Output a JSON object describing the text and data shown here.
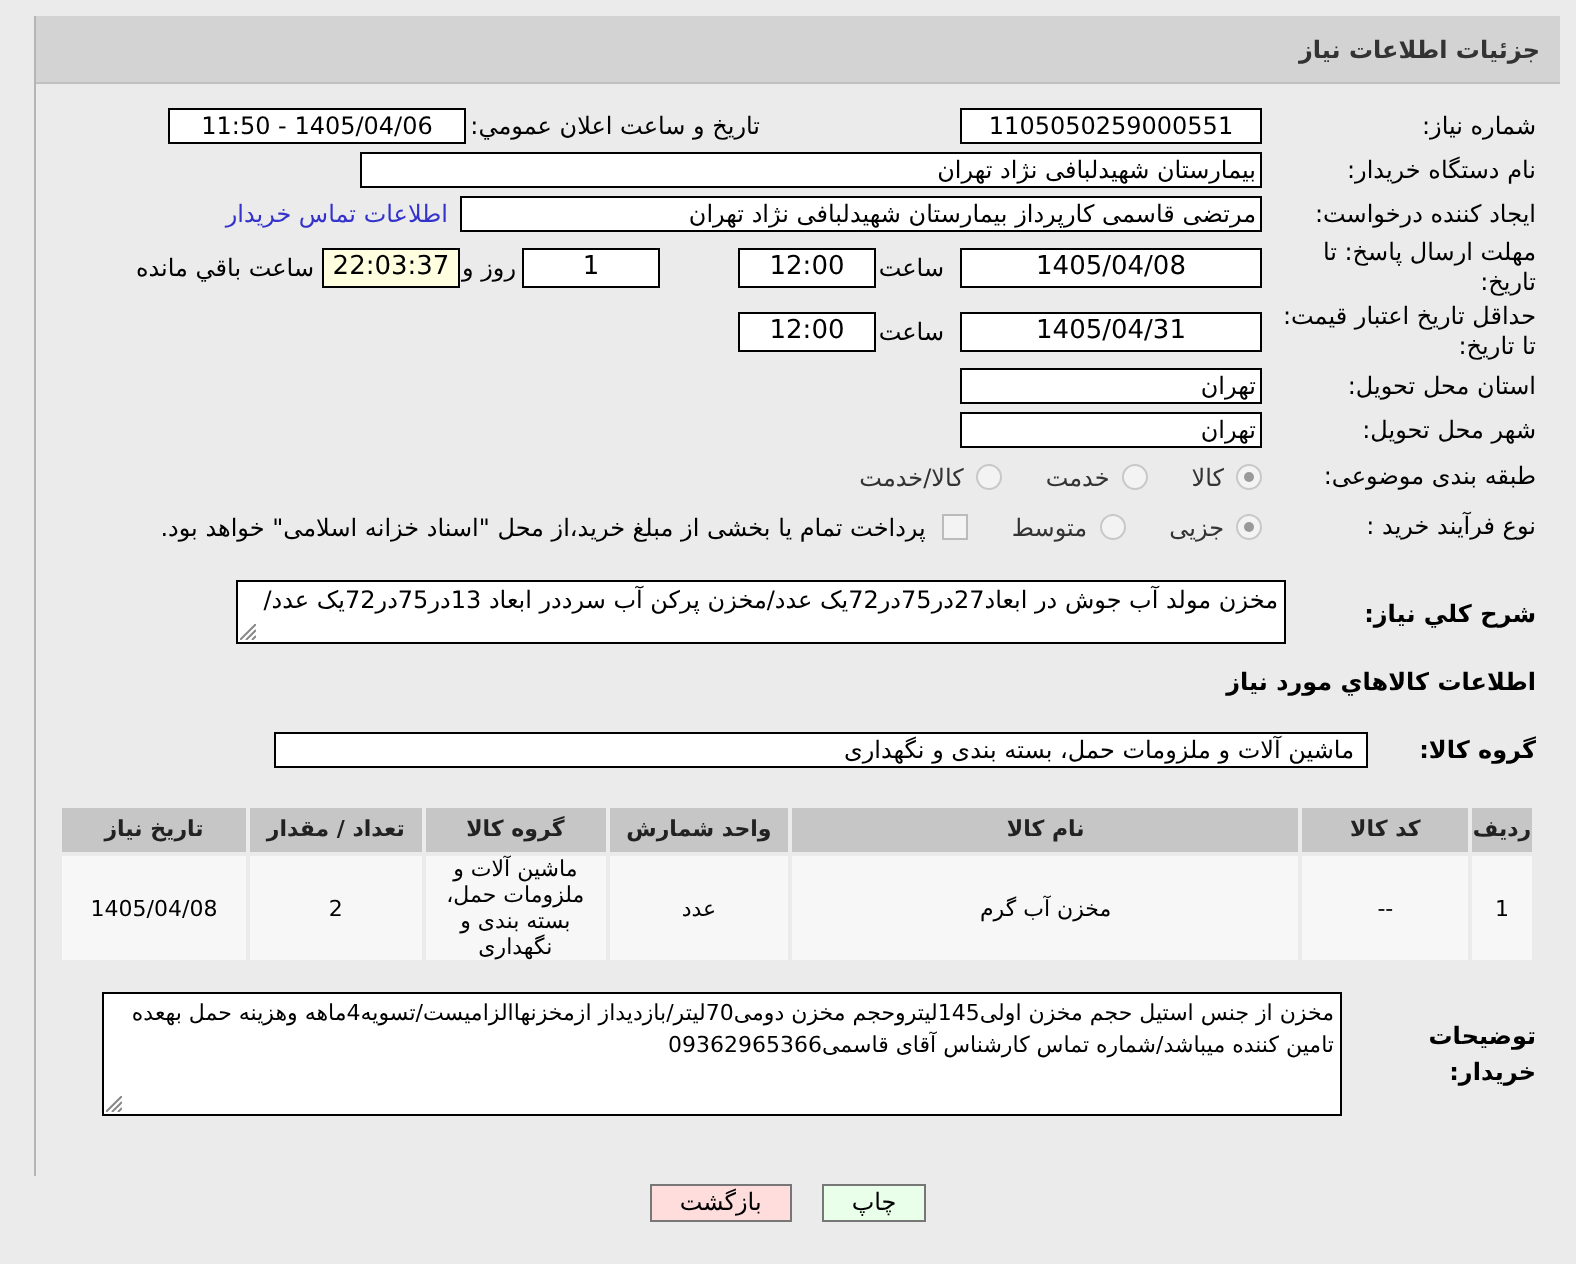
{
  "header": {
    "title": "جزئیات اطلاعات نیاز"
  },
  "need_number": {
    "label": "شماره نیاز:",
    "value": "1105050259000551"
  },
  "announce": {
    "label": "تاریخ و ساعت اعلان عمومي:",
    "value": "1405/04/06 - 11:50"
  },
  "buyer_org": {
    "label": "نام دستگاه خریدار:",
    "value": "بیمارستان شهیدلبافی نژاد تهران"
  },
  "requester": {
    "label": "ایجاد کننده درخواست:",
    "value": "مرتضی  قاسمی کارپرداز بیمارستان شهیدلبافی نژاد تهران",
    "link": "اطلاعات تماس خریدار"
  },
  "deadline": {
    "label": "مهلت ارسال پاسخ: تا تاریخ:",
    "date": "1405/04/08",
    "time_label": "ساعت",
    "time": "12:00",
    "days": "1",
    "days_label": "روز و",
    "remaining": "22:03:37",
    "remaining_label": "ساعت باقي مانده"
  },
  "validity": {
    "label": "حداقل تاریخ اعتبار قیمت: تا تاریخ:",
    "date": "1405/04/31",
    "time_label": "ساعت",
    "time": "12:00"
  },
  "province": {
    "label": "استان محل تحویل:",
    "value": "تهران"
  },
  "city": {
    "label": "شهر محل تحویل:",
    "value": "تهران"
  },
  "category": {
    "label": "طبقه بندی موضوعی:",
    "options": [
      {
        "label": "کالا",
        "selected": true
      },
      {
        "label": "خدمت",
        "selected": false
      },
      {
        "label": "کالا/خدمت",
        "selected": false
      }
    ]
  },
  "process": {
    "label": "نوع فرآیند خرید :",
    "options": [
      {
        "label": "جزیی",
        "selected": true
      },
      {
        "label": "متوسط",
        "selected": false
      }
    ],
    "treasury": {
      "label": "پرداخت تمام یا بخشی از مبلغ خرید،از محل \"اسناد خزانه اسلامی\" خواهد بود.",
      "checked": false
    }
  },
  "description": {
    "label": "شرح کلي نیاز:",
    "value": "مخزن مولد آب جوش در ابعاد27در75در72یک عدد/مخزن پرکن آب سرددر ابعاد 13در75در72یک عدد/"
  },
  "goods_heading": "اطلاعات کالاهاي مورد نیاز",
  "goods_group": {
    "label": "گروه کالا:",
    "value": "ماشین آلات و ملزومات حمل، بسته بندی و نگهداری"
  },
  "table": {
    "columns": [
      "ردیف",
      "کد کالا",
      "نام کالا",
      "واحد شمارش",
      "گروه کالا",
      "تعداد / مقدار",
      "تاریخ نیاز"
    ],
    "rows": [
      [
        "1",
        "--",
        "مخزن آب گرم",
        "عدد",
        "ماشین آلات و ملزومات حمل، بسته بندی و نگهداری",
        "2",
        "1405/04/08"
      ]
    ]
  },
  "buyer_notes": {
    "label": "توضیحات خریدار:",
    "value": "مخزن از جنس استیل حجم مخزن اولی145لیتروحجم مخزن دومی70لیتر/بازدیداز ازمخزنهاالزامیست/تسویه4ماهه وهزینه حمل بهعده تامین کننده میباشد/شماره تماس کارشناس آقای قاسمی09362965366"
  },
  "buttons": [
    {
      "label": "چاپ",
      "kind": "print"
    },
    {
      "label": "بازگشت",
      "kind": "back"
    }
  ]
}
